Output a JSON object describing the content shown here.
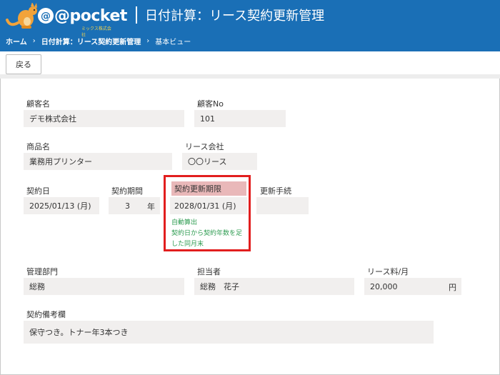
{
  "header": {
    "logo_text": "@pocket",
    "logo_sub": "ミックス株式会社",
    "title": "日付計算：リース契約更新管理",
    "breadcrumb": {
      "home": "ホーム",
      "app": "日付計算：リース契約更新管理",
      "view": "基本ビュー"
    }
  },
  "toolbar": {
    "back_label": "戻る"
  },
  "form": {
    "customer_name": {
      "label": "顧客名",
      "value": "デモ株式会社"
    },
    "customer_no": {
      "label": "顧客No",
      "value": "101"
    },
    "product_name": {
      "label": "商品名",
      "value": "業務用プリンター"
    },
    "lease_company": {
      "label": "リース会社",
      "value": "〇〇リース"
    },
    "contract_date": {
      "label": "契約日",
      "value": "2025/01/13 (月)"
    },
    "contract_period": {
      "label": "契約期間",
      "value": "3",
      "unit": "年"
    },
    "renewal_deadline": {
      "label": "契約更新期限",
      "value": "2028/01/31 (月)",
      "note_lines": [
        "自動算出",
        "契約日から契約年数を足",
        "した同月末"
      ]
    },
    "renewal_procedure": {
      "label": "更新手続",
      "value": ""
    },
    "department": {
      "label": "管理部門",
      "value": "総務"
    },
    "person": {
      "label": "担当者",
      "value": "総務　花子"
    },
    "lease_fee": {
      "label": "リース料/月",
      "value": "20,000",
      "unit": "円"
    },
    "remarks": {
      "label": "契約備考欄",
      "value": "保守つき。トナー年3本つき"
    }
  },
  "colors": {
    "header_bg": "#1a6fb6",
    "highlight_border": "#e21e1e",
    "highlight_label_bg": "#e9b8b9",
    "note_text": "#2f9c52",
    "field_bg": "#f1efee"
  }
}
